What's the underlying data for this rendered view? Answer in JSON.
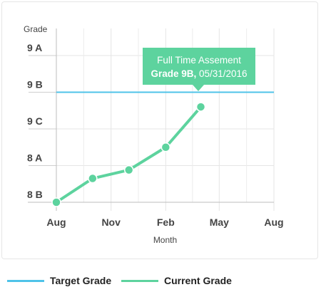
{
  "chart_data": {
    "type": "line",
    "ylabel": "Grade",
    "xlabel": "Month",
    "y_categories": [
      "8 B",
      "8 A",
      "9 C",
      "9 B",
      "9 A"
    ],
    "x_ticks": [
      {
        "date": "2015-08-01",
        "label": "Aug"
      },
      {
        "date": "2015-11-01",
        "label": "Nov"
      },
      {
        "date": "2016-02-01",
        "label": "Feb"
      },
      {
        "date": "2016-05-01",
        "label": "May"
      },
      {
        "date": "2016-08-01",
        "label": "Aug"
      }
    ],
    "xlim": [
      "2015-08-01",
      "2016-08-01"
    ],
    "ylim": [
      0,
      4.2
    ],
    "grid": true,
    "series": [
      {
        "name": "Target Grade",
        "color": "#4fc3e8",
        "type": "constant",
        "y": 3.0
      },
      {
        "name": "Current Grade",
        "color": "#5dd39e",
        "points": [
          {
            "date": "2015-08-01",
            "y": 0.0
          },
          {
            "date": "2015-10-01",
            "y": 0.65
          },
          {
            "date": "2015-12-01",
            "y": 0.88
          },
          {
            "date": "2016-02-01",
            "y": 1.5
          },
          {
            "date": "2016-03-31",
            "y": 2.6
          }
        ]
      }
    ],
    "tooltip": {
      "line1": "Full Time Assement",
      "line2_bold": "Grade 9B,",
      "line2_rest": " 05/31/2016"
    },
    "legend_position": "bottom"
  }
}
